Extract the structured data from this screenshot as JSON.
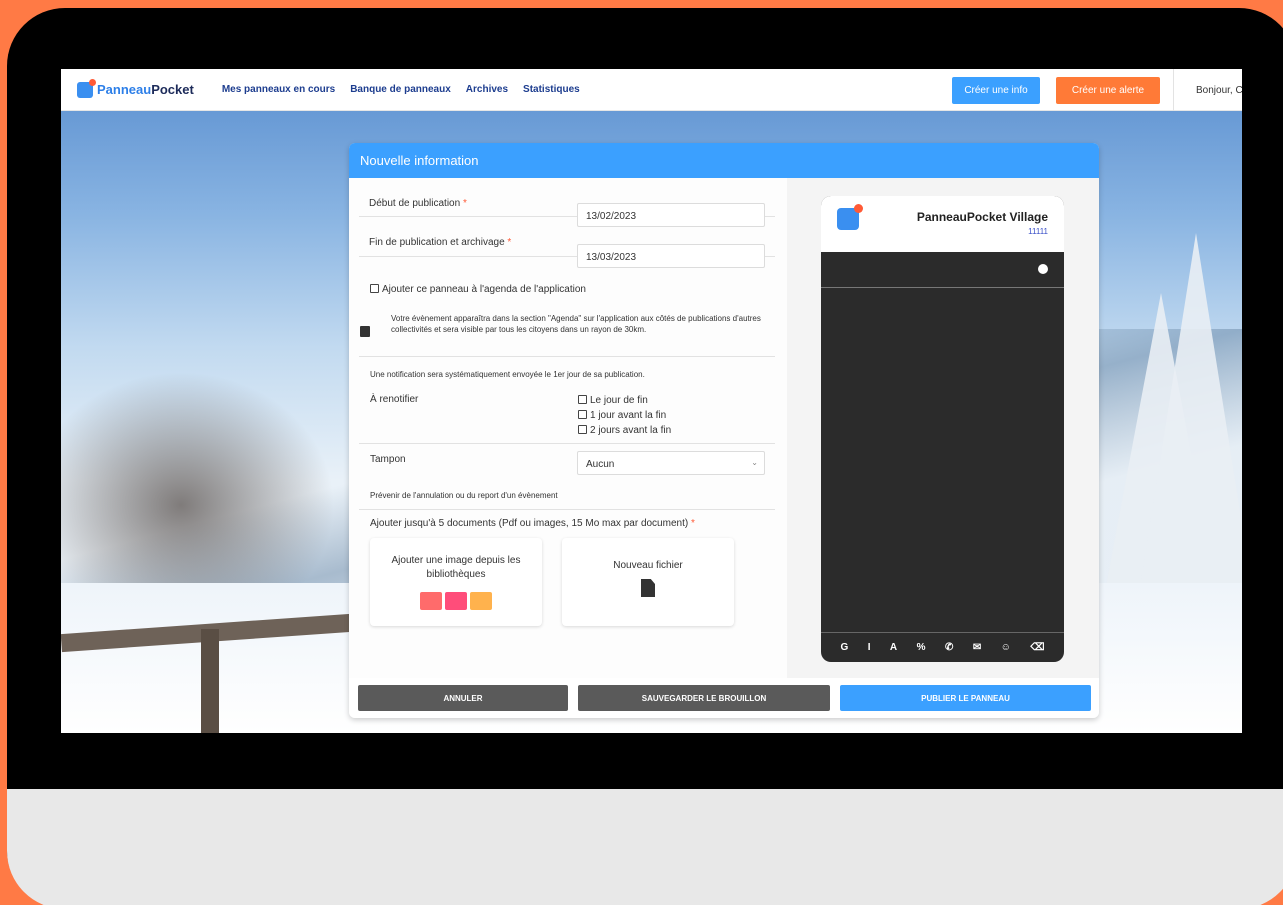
{
  "brand": {
    "name_part1": "Panneau",
    "name_part2": "Pocket",
    "primary": "#3ba0ff",
    "accent": "#ff7a37"
  },
  "nav": {
    "items": [
      "Mes panneaux en cours",
      "Banque de panneaux",
      "Archives",
      "Statistiques"
    ]
  },
  "header": {
    "create_info": "Créer une info",
    "create_alert": "Créer une alerte",
    "greeting": "Bonjour, C"
  },
  "form": {
    "title": "Nouvelle information",
    "start_label": "Début de publication",
    "start_value": "13/02/2023",
    "end_label": "Fin de publication et archivage",
    "end_value": "13/03/2023",
    "required_mark": "*",
    "agenda_label": "Ajouter ce panneau à l'agenda de l'application",
    "agenda_note": "Votre évènement apparaîtra dans la section \"Agenda\" sur l'application aux côtés de publications d'autres collectivités et sera visible par tous les citoyens dans un rayon de 30km.",
    "notification_note": "Une notification sera systématiquement envoyée le 1er jour de sa publication.",
    "renotify_label": "À renotifier",
    "renotify_options": [
      "Le jour de fin",
      "1 jour avant la fin",
      "2 jours avant la fin"
    ],
    "stamp_label": "Tampon",
    "stamp_value": "Aucun",
    "cancel_note": "Prévenir de l'annulation ou du report d'un évènement",
    "documents_label": "Ajouter jusqu'à 5 documents (Pdf ou images, 15 Mo max par document)",
    "library_card": "Ajouter une image depuis les bibliothèques",
    "new_file_card": "Nouveau fichier"
  },
  "preview": {
    "title": "PanneauPocket Village",
    "subtitle": "11111",
    "tools": [
      "G",
      "I",
      "A",
      "%",
      "✆",
      "✉",
      "☺",
      "⌫"
    ]
  },
  "actions": {
    "cancel": "ANNULER",
    "save_draft": "SAUVEGARDER LE BROUILLON",
    "publish": "PUBLIER LE PANNEAU"
  }
}
